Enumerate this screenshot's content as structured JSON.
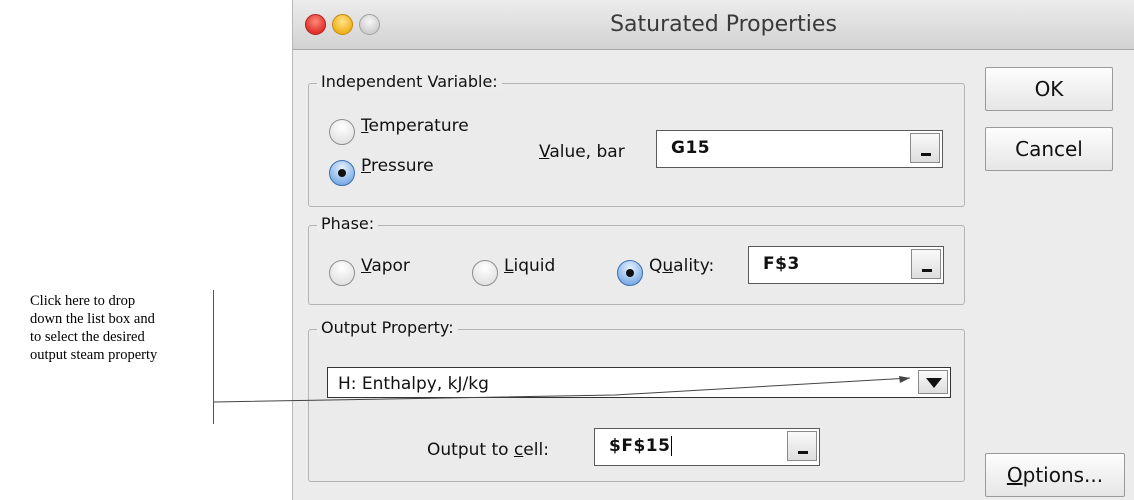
{
  "annotation": {
    "lines": [
      "Click here to drop",
      "down the list box and",
      "to select the desired",
      "output steam property"
    ]
  },
  "window": {
    "title": "Saturated Properties"
  },
  "independent_variable": {
    "legend": "Independent Variable:",
    "temperature": {
      "mn": "T",
      "rest": "emperature",
      "selected": false
    },
    "pressure": {
      "mn": "P",
      "rest": "ressure",
      "selected": true
    },
    "value_label": {
      "mn": "V",
      "rest": "alue, bar"
    },
    "value": "G15"
  },
  "phase": {
    "legend": "Phase:",
    "vapor": {
      "mn": "V",
      "rest": "apor",
      "selected": false
    },
    "liquid": {
      "mn": "L",
      "rest": "iquid",
      "selected": false
    },
    "quality": {
      "pre": "Q",
      "mn": "u",
      "rest": "ality:",
      "selected": true
    },
    "quality_value": "F$3"
  },
  "output": {
    "legend": "Output Property:",
    "selected_property": "H: Enthalpy, kJ/kg",
    "cell_label": {
      "pre": "Output to ",
      "mn": "c",
      "rest": "ell:"
    },
    "cell_value": "$F$15"
  },
  "buttons": {
    "ok": "OK",
    "cancel": "Cancel",
    "options": {
      "mn": "O",
      "rest": "ptions..."
    }
  }
}
